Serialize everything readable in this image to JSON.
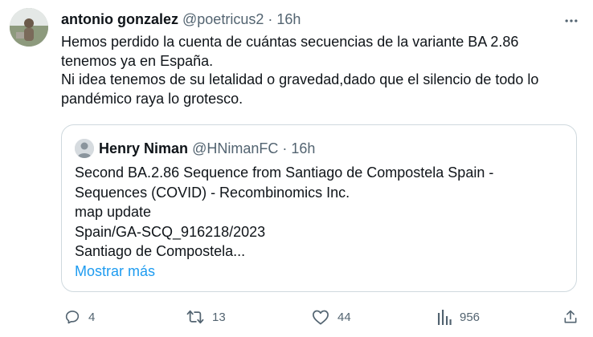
{
  "tweet": {
    "author_name": "antonio gonzalez",
    "handle": "@poetricus2",
    "separator": "·",
    "time": "16h",
    "text_lines": [
      "Hemos perdido la cuenta de cuántas secuencias de la variante BA 2.86",
      "tenemos ya en España.",
      "Ni idea tenemos de su letalidad o gravedad,dado que el silencio de todo lo",
      "pandémico raya lo grotesco."
    ]
  },
  "quoted_tweet": {
    "author_name": "Henry Niman",
    "handle": "@HNimanFC",
    "separator": "·",
    "time": "16h",
    "text_lines": [
      "Second BA.2.86 Sequence from Santiago de Compostela Spain -",
      "Sequences (COVID) - Recombinomics Inc.",
      "map update",
      "Spain/GA-SCQ_916218/2023",
      "Santiago de Compostela..."
    ],
    "show_more": "Mostrar más"
  },
  "actions": {
    "replies": "4",
    "retweets": "13",
    "likes": "44",
    "views": "956"
  },
  "icons": {
    "more": "more-horizontal-icon",
    "reply": "reply-icon",
    "retweet": "retweet-icon",
    "like": "heart-icon",
    "views": "views-chart-icon",
    "share": "share-icon"
  },
  "colors": {
    "text": "#0f1419",
    "secondary": "#536471",
    "link": "#1d9bf0",
    "border": "#cfd9de"
  }
}
